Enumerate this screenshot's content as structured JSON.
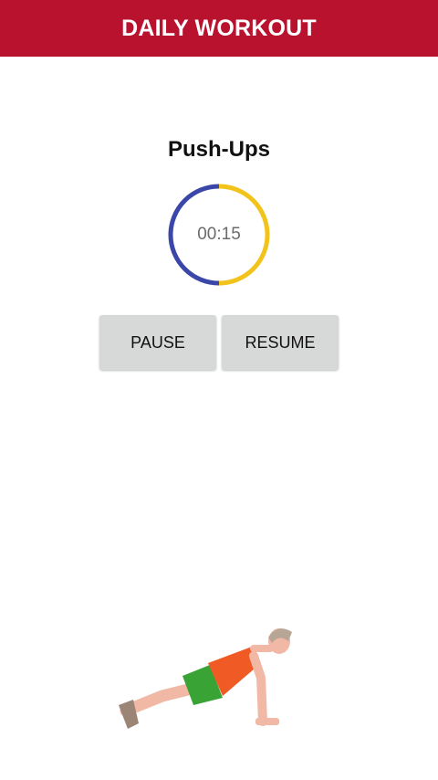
{
  "app_bar": {
    "title": "DAILY WORKOUT",
    "color": "#b8122f"
  },
  "exercise": {
    "name": "Push-Ups"
  },
  "timer": {
    "display": "00:15",
    "progress_fraction": 0.5,
    "colors": {
      "remaining": "#3a47a8",
      "elapsed": "#f2c31b"
    }
  },
  "controls": {
    "pause_label": "PAUSE",
    "resume_label": "RESUME"
  },
  "illustration": {
    "icon": "push-up-figure-icon"
  }
}
